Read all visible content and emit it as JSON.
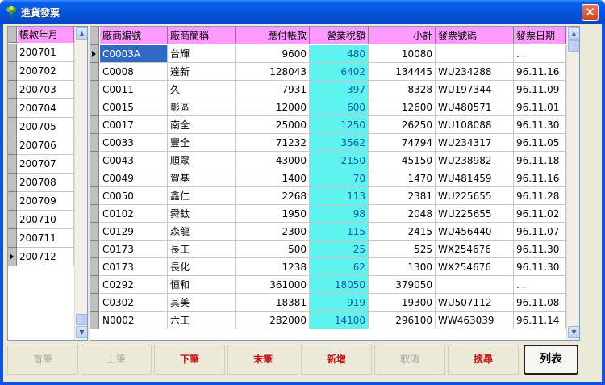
{
  "window": {
    "title": "進貨發票",
    "close_glyph": "✕"
  },
  "periods": {
    "header": "帳款年月",
    "items": [
      "200701",
      "200702",
      "200703",
      "200704",
      "200705",
      "200706",
      "200707",
      "200708",
      "200709",
      "200710",
      "200711",
      "200712"
    ],
    "current_index": 11
  },
  "grid": {
    "columns": [
      "廠商編號",
      "廠商簡稱",
      "應付帳款",
      "營業稅額",
      "小計",
      "發票號碼",
      "發票日期"
    ],
    "rows": [
      [
        "C0003A",
        "台輝",
        "9600",
        "480",
        "10080",
        "",
        ". ."
      ],
      [
        "C0008",
        "達新",
        "128043",
        "6402",
        "134445",
        "WU234288",
        "96.11.16"
      ],
      [
        "C0011",
        "久",
        "7931",
        "397",
        "8328",
        "WU197344",
        "96.11.09"
      ],
      [
        "C0015",
        "彰區",
        "12000",
        "600",
        "12600",
        "WU480571",
        "96.11.01"
      ],
      [
        "C0017",
        "南全",
        "25000",
        "1250",
        "26250",
        "WU108088",
        "96.11.30"
      ],
      [
        "C0033",
        "豐全",
        "71232",
        "3562",
        "74794",
        "WU234317",
        "96.11.05"
      ],
      [
        "C0043",
        "順眾",
        "43000",
        "2150",
        "45150",
        "WU238982",
        "96.11.18"
      ],
      [
        "C0049",
        "賀基",
        "1400",
        "70",
        "1470",
        "WU481459",
        "96.11.16"
      ],
      [
        "C0050",
        "鑫仁",
        "2268",
        "113",
        "2381",
        "WU225655",
        "96.11.28"
      ],
      [
        "C0102",
        "舜鈦",
        "1950",
        "98",
        "2048",
        "WU225655",
        "96.11.02"
      ],
      [
        "C0129",
        "森龍",
        "2300",
        "115",
        "2415",
        "WU456440",
        "96.11.07"
      ],
      [
        "C0173",
        "長工",
        "500",
        "25",
        "525",
        "WX254676",
        "96.11.30"
      ],
      [
        "C0173",
        "長化",
        "1238",
        "62",
        "1300",
        "WX254676",
        "96.11.30"
      ],
      [
        "C0292",
        "恒和",
        "361000",
        "18050",
        "379050",
        "",
        ". ."
      ],
      [
        "C0302",
        "其美",
        "18381",
        "919",
        "19300",
        "WU507112",
        "96.11.08"
      ],
      [
        "N0002",
        "六工",
        "282000",
        "14100",
        "296100",
        "WW463039",
        "96.11.14"
      ]
    ],
    "current_row": 0
  },
  "toolbar": {
    "first": "首筆",
    "prev": "上筆",
    "next": "下筆",
    "last": "末筆",
    "add": "新增",
    "cancel": "取消",
    "search": "搜尋",
    "list": "列表"
  },
  "colors": {
    "header_bg": "#ff9bff",
    "tax_column_bg": "#5ff3ef",
    "selected_cell_bg": "#3169c6",
    "active_button_text": "#c41010",
    "titlebar": "#0656dc"
  }
}
